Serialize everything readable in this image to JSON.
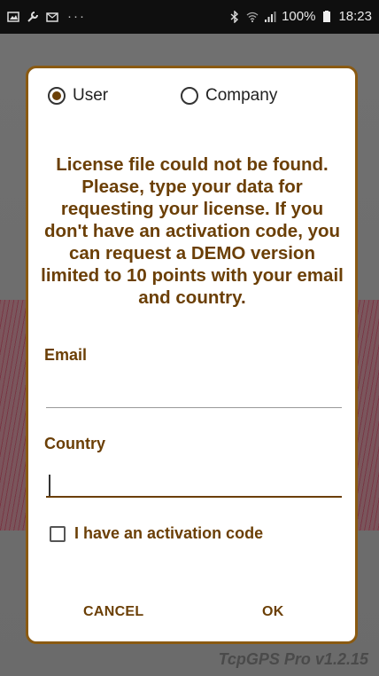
{
  "status_bar": {
    "left_icons": [
      "image-icon",
      "wrench-icon",
      "email-icon"
    ],
    "dots": "···",
    "battery_text": "100%",
    "time": "18:23",
    "right_icons": [
      "bluetooth-icon",
      "wifi-icon",
      "signal-icon",
      "battery-icon"
    ]
  },
  "dialog": {
    "radio_user_label": "User",
    "radio_company_label": "Company",
    "selected_radio": "User",
    "message": "License file could not be found. Please, type your data for requesting your license. If you don't have an activation code, you can request a DEMO version limited to 10 points with your email and country.",
    "email_label": "Email",
    "email_value": "",
    "country_label": "Country",
    "country_value": "",
    "activation_checkbox_label": "I have an activation code",
    "activation_checked": false,
    "cancel_label": "CANCEL",
    "ok_label": "OK"
  },
  "background": {
    "version_text": "TcpGPS Pro v1.2.15"
  },
  "colors": {
    "accent": "#6b3f06",
    "dialog_border": "#8a5a12",
    "statusbar_bg": "#0f0f0f"
  }
}
